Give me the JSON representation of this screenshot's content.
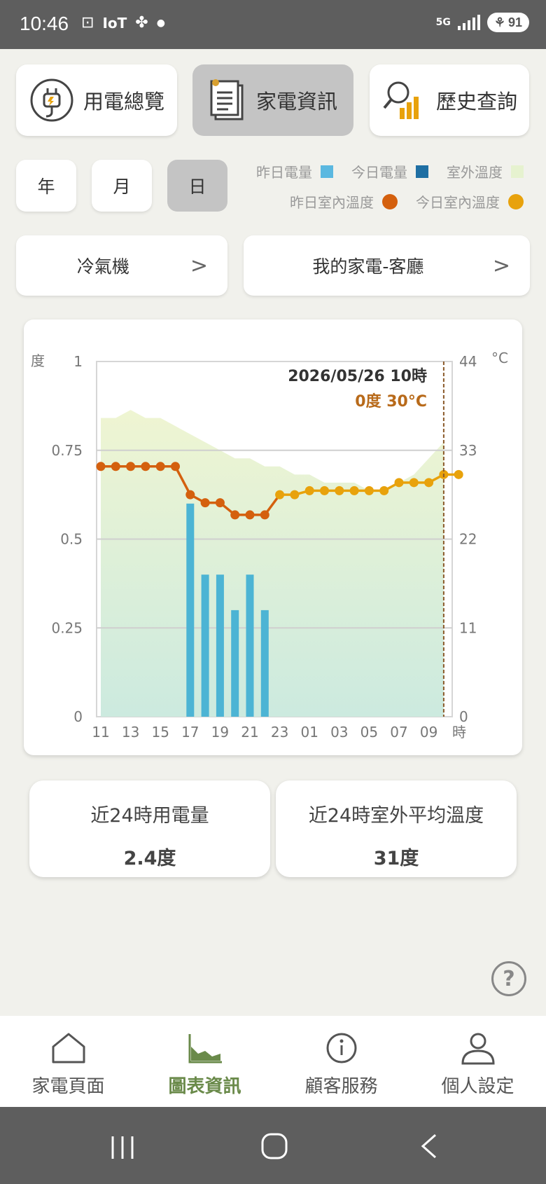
{
  "status_bar": {
    "time": "10:46",
    "iot": "IoT",
    "network": "5G",
    "battery": "91"
  },
  "top_tabs": [
    {
      "label": "用電總覽",
      "active": false
    },
    {
      "label": "家電資訊",
      "active": true
    },
    {
      "label": "歷史查詢",
      "active": false
    }
  ],
  "period_buttons": [
    {
      "label": "年",
      "active": false
    },
    {
      "label": "月",
      "active": false
    },
    {
      "label": "日",
      "active": true
    }
  ],
  "legend": {
    "yesterday_power": {
      "label": "昨日電量",
      "color": "#5bb8e0"
    },
    "today_power": {
      "label": "今日電量",
      "color": "#1f6fa3"
    },
    "outdoor_temp": {
      "label": "室外溫度",
      "color": "#e6f2cf"
    },
    "yesterday_indoor": {
      "label": "昨日室內溫度",
      "color": "#d4600e"
    },
    "today_indoor": {
      "label": "今日室內溫度",
      "color": "#e8a20c"
    }
  },
  "selectors": {
    "appliance": "冷氣機",
    "location": "我的家電-客廳"
  },
  "chart_data": {
    "type": "bar+line+area",
    "y_left_label": "度",
    "y_right_label": "°C",
    "y_left_ticks": [
      "1",
      "0.75",
      "0.5",
      "0.25",
      "0"
    ],
    "y_right_ticks": [
      "44",
      "33",
      "22",
      "11",
      "0"
    ],
    "ylim_left": [
      0,
      1
    ],
    "ylim_right": [
      0,
      44
    ],
    "x_unit": "時",
    "x_tick_labels": [
      "11",
      "13",
      "15",
      "17",
      "19",
      "21",
      "23",
      "01",
      "03",
      "05",
      "07",
      "09"
    ],
    "hours": [
      "11",
      "12",
      "13",
      "14",
      "15",
      "16",
      "17",
      "18",
      "19",
      "20",
      "21",
      "22",
      "23",
      "00",
      "01",
      "02",
      "03",
      "04",
      "05",
      "06",
      "07",
      "08",
      "09",
      "10"
    ],
    "power_yesterday": [
      0,
      0,
      0,
      0,
      0,
      0,
      0.6,
      0.4,
      0.4,
      0.3,
      0.4,
      0.3,
      0,
      0,
      0,
      0,
      0,
      0,
      0,
      0,
      0,
      0,
      0,
      0
    ],
    "outdoor_temp": [
      37,
      37,
      38,
      37,
      37,
      36,
      35,
      34,
      33,
      32,
      32,
      31,
      31,
      30,
      30,
      29,
      29,
      29,
      28,
      28,
      29,
      30,
      32,
      34
    ],
    "indoor_yesterday": [
      31,
      31,
      31,
      31,
      31,
      31,
      27.5,
      26.5,
      26.5,
      25,
      25,
      25
    ],
    "indoor_today": [
      27.5,
      27.5,
      28,
      28,
      28,
      28,
      28,
      28,
      29,
      29,
      29,
      30,
      30
    ],
    "cursor": {
      "date": "2026/05/26 10時",
      "value": "0度 30°C"
    }
  },
  "stats": {
    "power_title": "近24時用電量",
    "power_value": "2.4度",
    "temp_title": "近24時室外平均溫度",
    "temp_value": "31度"
  },
  "help": "?",
  "nav": [
    {
      "label": "家電頁面",
      "active": false
    },
    {
      "label": "圖表資訊",
      "active": true
    },
    {
      "label": "顧客服務",
      "active": false
    },
    {
      "label": "個人設定",
      "active": false
    }
  ]
}
